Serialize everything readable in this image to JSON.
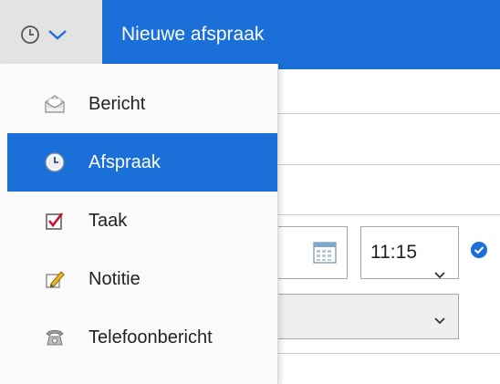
{
  "header": {
    "title": "Nieuwe afspraak",
    "type_icon": "clock-icon",
    "dropdown_icon": "chevron-down-icon",
    "accent_color": "#1a6fd8"
  },
  "menu": {
    "items": [
      {
        "label": "Bericht",
        "icon": "envelope-icon",
        "selected": false
      },
      {
        "label": "Afspraak",
        "icon": "clock-icon",
        "selected": true
      },
      {
        "label": "Taak",
        "icon": "checkbox-icon",
        "selected": false
      },
      {
        "label": "Notitie",
        "icon": "pencil-icon",
        "selected": false
      },
      {
        "label": "Telefoonbericht",
        "icon": "telephone-icon",
        "selected": false
      }
    ]
  },
  "form": {
    "start_time": "11:15",
    "time_icon": "chevron-down-icon",
    "date_icon": "calendar-icon",
    "all_day_icon": "check-circle-icon"
  }
}
